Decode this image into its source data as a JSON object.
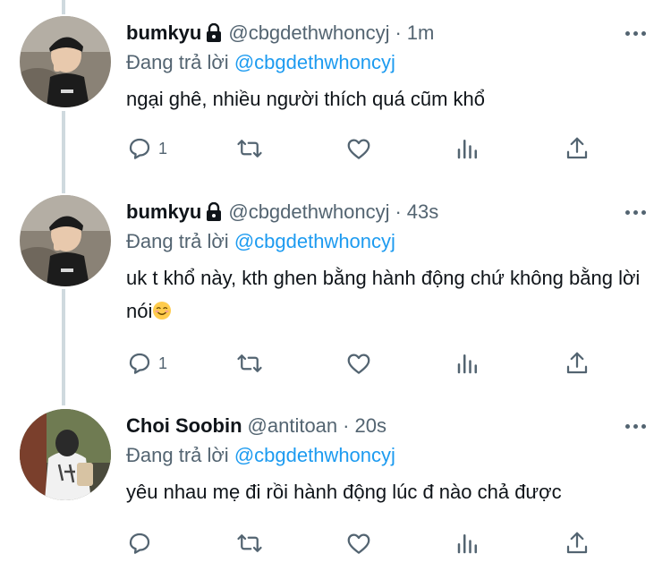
{
  "tweets": [
    {
      "display_name": "bumkyu",
      "protected": true,
      "handle": "@cbgdethwhoncyj",
      "separator": "·",
      "time": "1m",
      "reply_prefix": "Đang trả lời ",
      "reply_mention": "@cbgdethwhoncyj",
      "text": "ngại ghê, nhiều người thích quá cũm khổ",
      "reply_count": "1",
      "avatar": "boy-in-black-cap-photo"
    },
    {
      "display_name": "bumkyu",
      "protected": true,
      "handle": "@cbgdethwhoncyj",
      "separator": "·",
      "time": "43s",
      "reply_prefix": "Đang trả lời ",
      "reply_mention": "@cbgdethwhoncyj",
      "text": "uk t khổ này, kth ghen bằng hành động chứ không bằng lời nói",
      "emoji": "smiling-face-emoji",
      "reply_count": "1",
      "avatar": "boy-in-black-cap-photo"
    },
    {
      "display_name": "Choi Soobin",
      "protected": false,
      "handle": "@antitoan",
      "separator": "·",
      "time": "20s",
      "reply_prefix": "Đang trả lời ",
      "reply_mention": "@cbgdethwhoncyj",
      "text": "yêu nhau mẹ đi rồi hành động lúc đ nào chả được",
      "reply_count": "",
      "avatar": "person-from-behind-photo"
    }
  ],
  "icons": [
    "reply-icon",
    "retweet-icon",
    "like-icon",
    "analytics-icon",
    "share-icon",
    "lock-icon",
    "more-icon"
  ],
  "colors": {
    "link": "#1d9bf0",
    "secondary": "#536471",
    "text": "#0f1419",
    "thread_line": "#cfd9de"
  }
}
